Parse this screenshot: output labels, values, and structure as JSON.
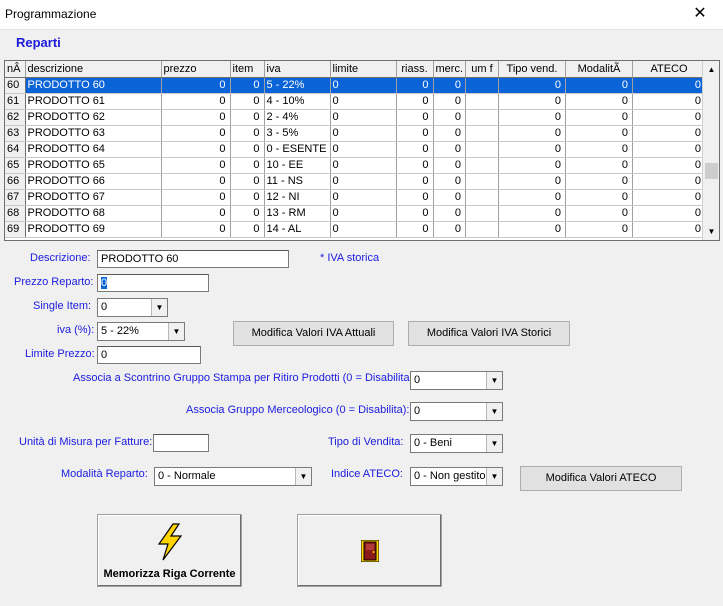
{
  "window": {
    "title": "Programmazione",
    "close_glyph": "✕"
  },
  "section_title": "Reparti",
  "grid": {
    "columns": [
      "nÂ",
      "descrizione",
      "prezzo",
      "item",
      "iva",
      "limite",
      "riass.",
      "merc.",
      "um f",
      "Tipo vend.",
      "ModalitÃ",
      "ATECO"
    ],
    "rows": [
      [
        "60",
        "PRODOTTO 60",
        "0",
        "0",
        "5 - 22%",
        "0",
        "0",
        "0",
        "",
        "0",
        "0",
        "0"
      ],
      [
        "61",
        "PRODOTTO 61",
        "0",
        "0",
        "4 - 10%",
        "0",
        "0",
        "0",
        "",
        "0",
        "0",
        "0"
      ],
      [
        "62",
        "PRODOTTO 62",
        "0",
        "0",
        "2 - 4%",
        "0",
        "0",
        "0",
        "",
        "0",
        "0",
        "0"
      ],
      [
        "63",
        "PRODOTTO 63",
        "0",
        "0",
        "3 - 5%",
        "0",
        "0",
        "0",
        "",
        "0",
        "0",
        "0"
      ],
      [
        "64",
        "PRODOTTO 64",
        "0",
        "0",
        "0 - ESENTE",
        "0",
        "0",
        "0",
        "",
        "0",
        "0",
        "0"
      ],
      [
        "65",
        "PRODOTTO 65",
        "0",
        "0",
        "10 - EE",
        "0",
        "0",
        "0",
        "",
        "0",
        "0",
        "0"
      ],
      [
        "66",
        "PRODOTTO 66",
        "0",
        "0",
        "11 - NS",
        "0",
        "0",
        "0",
        "",
        "0",
        "0",
        "0"
      ],
      [
        "67",
        "PRODOTTO 67",
        "0",
        "0",
        "12 - NI",
        "0",
        "0",
        "0",
        "",
        "0",
        "0",
        "0"
      ],
      [
        "68",
        "PRODOTTO 68",
        "0",
        "0",
        "13 - RM",
        "0",
        "0",
        "0",
        "",
        "0",
        "0",
        "0"
      ],
      [
        "69",
        "PRODOTTO 69",
        "0",
        "0",
        "14 - AL",
        "0",
        "0",
        "0",
        "",
        "0",
        "0",
        "0"
      ]
    ],
    "selected_row": 0
  },
  "form": {
    "descrizione_label": "Descrizione:",
    "descrizione_value": "PRODOTTO 60",
    "iva_storica_note": "* IVA storica",
    "prezzo_label": "Prezzo Reparto:",
    "prezzo_value": "0",
    "single_item_label": "Single Item:",
    "single_item_value": "0",
    "iva_label": "iva (%):",
    "iva_value": "5 - 22%",
    "limite_label": "Limite Prezzo:",
    "limite_value": "0",
    "modifica_iva_attuali": "Modifica Valori IVA Attuali",
    "modifica_iva_storici": "Modifica Valori IVA Storici",
    "gruppo_stampa_label": "Associa a Scontrino Gruppo Stampa per Ritiro Prodotti (0 = Disabilita):",
    "gruppo_stampa_value": "0",
    "gruppo_merc_label": "Associa Gruppo Merceologico (0 = Disabilita):",
    "gruppo_merc_value": "0",
    "unita_label": "Unità di Misura per Fatture:",
    "unita_value": "",
    "tipo_vendita_label": "Tipo di Vendita:",
    "tipo_vendita_value": "0 - Beni",
    "modalita_label": "Modalità Reparto:",
    "modalita_value": "0 - Normale",
    "ateco_label": "Indice ATECO:",
    "ateco_value": "0 - Non gestito",
    "modifica_ateco": "Modifica Valori ATECO"
  },
  "actions": {
    "memorizza_label": "Memorizza Riga Corrente",
    "memorizza_icon": "lightning-icon",
    "exit_icon": "door-icon"
  },
  "colors": {
    "label_blue": "#1b1be0",
    "selection": "#0a64d8",
    "lightning": "#ffd400"
  }
}
